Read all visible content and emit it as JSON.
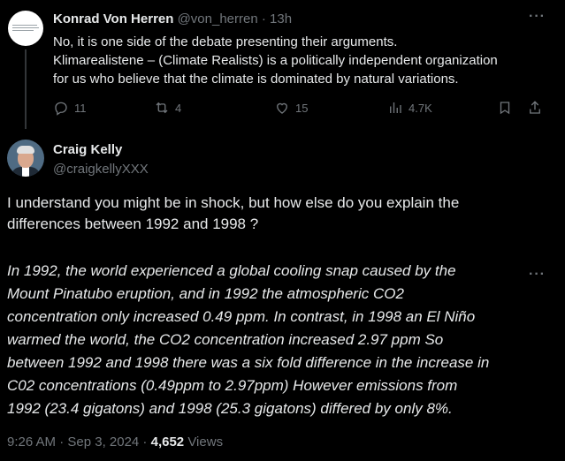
{
  "reply": {
    "name": "Konrad Von Herren",
    "handle": "@von_herren",
    "separator": "·",
    "time": "13h",
    "text_lines": [
      "No, it is one side of the debate presenting their arguments.",
      "Klimarealistene – (Climate Realists) is a politically independent organization",
      "for us who believe that the climate is dominated by natural variations."
    ],
    "stats": {
      "replies": "11",
      "reposts": "4",
      "likes": "15",
      "views": "4.7K"
    }
  },
  "tweet": {
    "name": "Craig Kelly",
    "handle": "@craigkellyXXX",
    "intro_lines": [
      "I understand you might be in shock, but how else do you explain the",
      "differences between 1992 and 1998 ?"
    ],
    "body_lines": [
      "In 1992, the world experienced a global cooling  snap caused by the",
      "Mount Pinatubo eruption, and in 1992 the atmospheric CO2",
      "concentration only  increased 0.49 ppm.    In contrast, in 1998 an El Niño",
      "warmed the world, the CO2 concentration increased 2.97 ppm   So",
      "between 1992 and 1998 there was a six fold difference in the increase in",
      "C02 concentrations (0.49ppm to 2.97ppm)   However emissions from",
      "1992 (23.4 gigatons) and 1998 (25.3 gigatons) differed by only 8%."
    ],
    "timestamp": "9:26 AM · Sep 3, 2024 ·",
    "views_count": "4,652",
    "views_label": "Views"
  },
  "icons": {
    "more": "more-icon",
    "reply": "reply-icon",
    "repost": "repost-icon",
    "like": "heart-icon",
    "views": "views-icon",
    "bookmark": "bookmark-icon",
    "share": "share-icon"
  },
  "colors": {
    "background": "#000000",
    "text": "#e7e9ea",
    "secondary": "#71767b",
    "thread_line": "#333639"
  }
}
